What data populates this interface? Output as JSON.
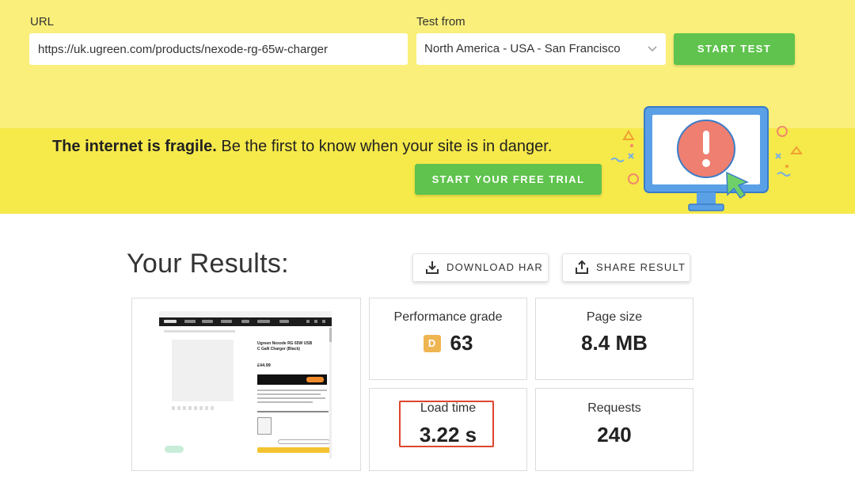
{
  "form": {
    "url_label": "URL",
    "url_value": "https://uk.ugreen.com/products/nexode-rg-65w-charger",
    "test_from_label": "Test from",
    "test_from_value": "North America - USA - San Francisco",
    "start_button": "START TEST"
  },
  "promo": {
    "headline_bold": "The internet is fragile.",
    "headline_rest": " Be the first to know when your site is in danger.",
    "trial_button": "START YOUR FREE TRIAL"
  },
  "results": {
    "title": "Your Results:",
    "download_button": "DOWNLOAD HAR",
    "share_button": "SHARE RESULT",
    "screenshot": {
      "product_name": "Ugreen Nexode RG 65W USB C GaN Charger (Black)",
      "price": "£44.99"
    },
    "metrics": {
      "performance": {
        "label": "Performance grade",
        "grade": "D",
        "score": "63"
      },
      "page_size": {
        "label": "Page size",
        "value": "8.4 MB"
      },
      "load_time": {
        "label": "Load time",
        "value": "3.22 s"
      },
      "requests": {
        "label": "Requests",
        "value": "240"
      }
    }
  },
  "colors": {
    "form_band": "#f9ef7a",
    "promo_band": "#f6e94a",
    "accent_green": "#5fc34d",
    "grade_badge": "#efb551",
    "highlight_border": "#e0442f"
  },
  "icons": [
    "chevron-down-icon",
    "download-icon",
    "share-icon",
    "alert-monitor-illustration"
  ]
}
